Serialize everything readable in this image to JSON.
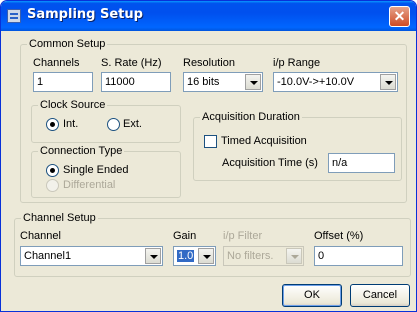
{
  "window": {
    "title": "Sampling Setup",
    "close_glyph": "✕",
    "titlebar_color": "#0055ea",
    "face_color": "#ece9d8"
  },
  "common_setup": {
    "legend": "Common Setup",
    "channels": {
      "label": "Channels",
      "value": "1"
    },
    "sample_rate": {
      "label": "S. Rate (Hz)",
      "value": "11000"
    },
    "resolution": {
      "label": "Resolution",
      "value": "16 bits"
    },
    "input_range": {
      "label": "i/p Range",
      "value": "-10.0V->+10.0V"
    }
  },
  "clock_source": {
    "legend": "Clock Source",
    "options": [
      {
        "label": "Int.",
        "selected": true
      },
      {
        "label": "Ext.",
        "selected": false
      }
    ]
  },
  "connection_type": {
    "legend": "Connection Type",
    "options": [
      {
        "label": "Single Ended",
        "selected": true,
        "enabled": true
      },
      {
        "label": "Differential",
        "selected": false,
        "enabled": false
      }
    ]
  },
  "acquisition_duration": {
    "legend": "Acquisition Duration",
    "timed_acquisition": {
      "label": "Timed Acquisition",
      "checked": false
    },
    "acquisition_time": {
      "label": "Acquisition Time (s)",
      "value": "n/a"
    }
  },
  "channel_setup": {
    "legend": "Channel Setup",
    "channel": {
      "label": "Channel",
      "value": "Channel1"
    },
    "gain": {
      "label": "Gain",
      "value": "1.0"
    },
    "input_filter": {
      "label": "i/p Filter",
      "value": "No filters.",
      "enabled": false
    },
    "offset": {
      "label": "Offset (%)",
      "value": "0"
    }
  },
  "buttons": {
    "ok": "OK",
    "cancel": "Cancel"
  }
}
